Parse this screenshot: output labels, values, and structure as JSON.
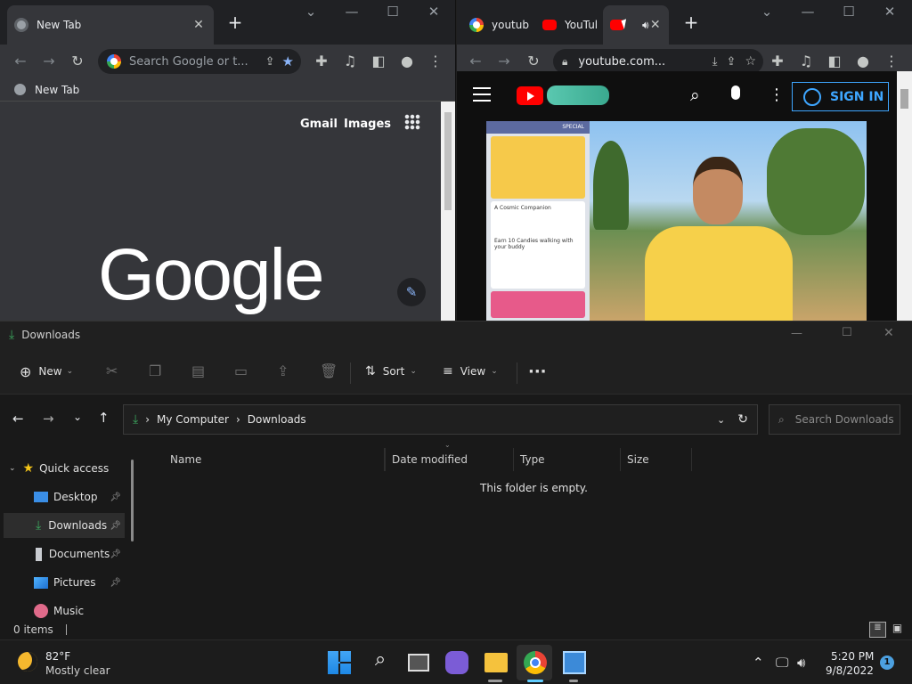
{
  "left_browser": {
    "tab_title": "New Tab",
    "omnibox_placeholder": "Search Google or t...",
    "bookmark_label": "New Tab",
    "links": {
      "gmail": "Gmail",
      "images": "Images"
    },
    "logo_text": "Google"
  },
  "right_browser": {
    "tabs": [
      {
        "label": "youtub"
      },
      {
        "label": "YouTul"
      },
      {
        "label": ""
      }
    ],
    "url": "youtube.com...",
    "yt_sign_in": "SIGN IN",
    "video_card_header": "SPECIAL",
    "video_card_items": [
      "A Cosmic Companion",
      "Earn 10 Candies walking with your buddy"
    ]
  },
  "explorer": {
    "title": "Downloads",
    "commands": {
      "new": "New",
      "sort": "Sort",
      "view": "View"
    },
    "breadcrumb": [
      "My Computer",
      "Downloads"
    ],
    "search_placeholder": "Search Downloads",
    "sidebar": [
      {
        "label": "Quick access"
      },
      {
        "label": "Desktop"
      },
      {
        "label": "Downloads"
      },
      {
        "label": "Documents"
      },
      {
        "label": "Pictures"
      },
      {
        "label": "Music"
      }
    ],
    "columns": [
      "Name",
      "Date modified",
      "Type",
      "Size"
    ],
    "empty_message": "This folder is empty.",
    "status": "0 items"
  },
  "taskbar": {
    "weather_temp": "82°F",
    "weather_desc": "Mostly clear",
    "time": "5:20 PM",
    "date": "9/8/2022",
    "notification_count": "1"
  },
  "colors": {
    "chrome_dark": "#202124",
    "chrome_toolbar": "#35363a",
    "youtube_red": "#ff0000",
    "youtube_sign_in": "#3ea6ff",
    "explorer_bg": "#191919",
    "downloads_green": "#3ba55d"
  }
}
